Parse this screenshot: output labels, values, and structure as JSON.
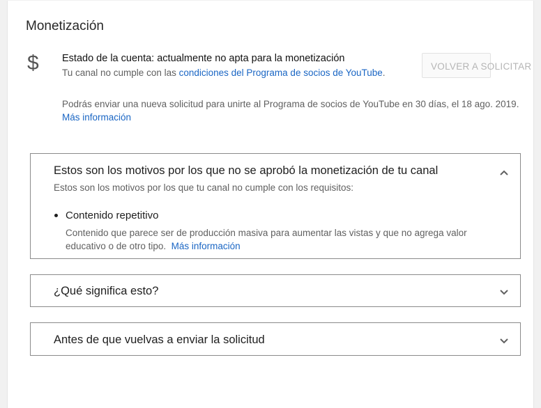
{
  "section_title": "Monetización",
  "account": {
    "icon": "dollar-icon",
    "status_text": "Estado de la cuenta: actualmente no apta para la monetización",
    "sub_prefix": "Tu canal no cumple con las ",
    "sub_link": "condiciones del Programa de socios de YouTube",
    "sub_suffix": ".",
    "reapply_button": "Volver a solicitar",
    "notice_text": "Podrás enviar una nueva solicitud para unirte al Programa de socios de YouTube en 30 días, el 18 ago. 2019. ",
    "notice_link": "Más información"
  },
  "panels": [
    {
      "title": "Estos son los motivos por los que no se aprobó la monetización de tu canal",
      "subtitle": "Estos son los motivos por los que tu canal no cumple con los requisitos:",
      "expanded": true,
      "reason_title": "Contenido repetitivo",
      "reason_desc": "Contenido que parece ser de producción masiva para aumentar las vistas y que no agrega valor educativo o de otro tipo.",
      "reason_link": "Más información"
    },
    {
      "title": "¿Qué significa esto?",
      "expanded": false
    },
    {
      "title": "Antes de que vuelvas a enviar la solicitud",
      "expanded": false
    }
  ],
  "colors": {
    "link": "#1a66c4",
    "muted_text": "#606060",
    "panel_border": "#8a8a8a"
  }
}
